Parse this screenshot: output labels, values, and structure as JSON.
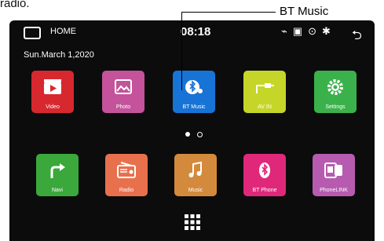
{
  "caption": "radio.",
  "callout": {
    "label": "BT Music"
  },
  "statusbar": {
    "home_label": "HOME",
    "time": "08:18",
    "icons": [
      "usb-icon",
      "screen-mirror-icon",
      "location-icon",
      "bluetooth-icon"
    ],
    "back_icon": "back-icon"
  },
  "date": "Sun.March 1,2020",
  "page_indicator": {
    "pages": 2,
    "current": 1
  },
  "apps_row1": [
    {
      "label": "Video",
      "color": "#d7282f",
      "icon": "video-icon"
    },
    {
      "label": "Photo",
      "color": "#c4539b",
      "icon": "photo-icon"
    },
    {
      "label": "BT Music",
      "color": "#1873d6",
      "icon": "bt-music-icon"
    },
    {
      "label": "AV IN",
      "color": "#c6d628",
      "icon": "av-in-icon"
    },
    {
      "label": "Settings",
      "color": "#3ab14a",
      "icon": "settings-icon"
    }
  ],
  "apps_row2": [
    {
      "label": "Navi",
      "color": "#3aa83a",
      "icon": "navi-icon"
    },
    {
      "label": "Radio",
      "color": "#e8704c",
      "icon": "radio-icon"
    },
    {
      "label": "Music",
      "color": "#d48a3c",
      "icon": "music-icon"
    },
    {
      "label": "BT Phone",
      "color": "#e0287a",
      "icon": "bt-phone-icon"
    },
    {
      "label": "PhoneLINK",
      "color": "#b65bb0",
      "icon": "phonelink-icon"
    }
  ],
  "app_drawer_icon": "apps-grid-icon"
}
